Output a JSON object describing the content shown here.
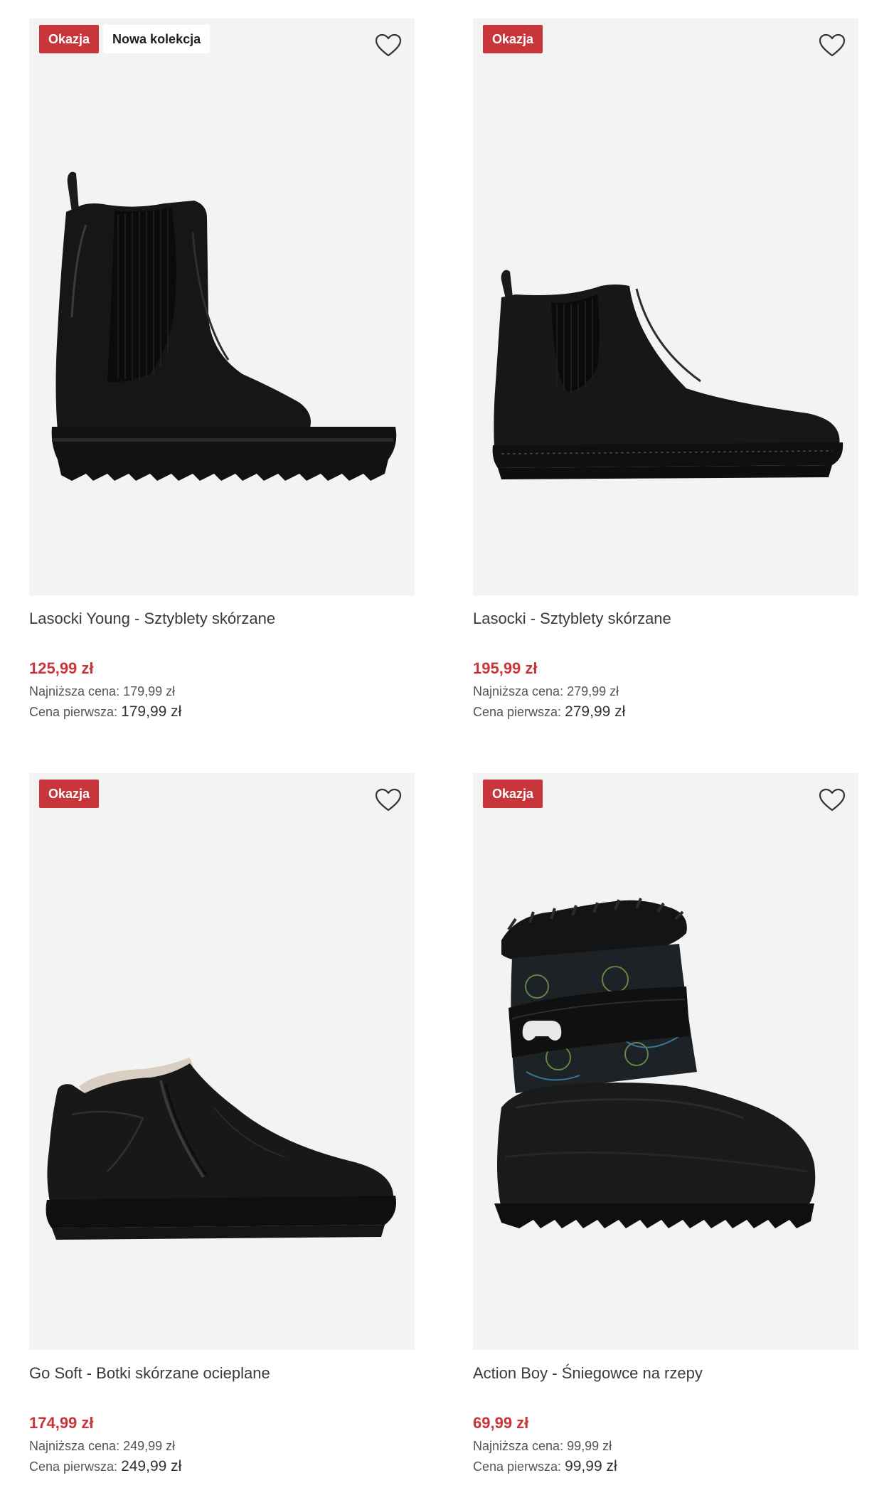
{
  "products": [
    {
      "badges": [
        "Okazja",
        "Nowa kolekcja"
      ],
      "name": "Lasocki Young - Sztyblety skórzane",
      "price": "125,99 zł",
      "lowest_label": "Najniższa cena:",
      "lowest_value": "179,99 zł",
      "first_label": "Cena pierwsza:",
      "first_value": "179,99 zł"
    },
    {
      "badges": [
        "Okazja"
      ],
      "name": "Lasocki - Sztyblety skórzane",
      "price": "195,99 zł",
      "lowest_label": "Najniższa cena:",
      "lowest_value": "279,99 zł",
      "first_label": "Cena pierwsza:",
      "first_value": "279,99 zł"
    },
    {
      "badges": [
        "Okazja"
      ],
      "name": "Go Soft - Botki skórzane ocieplane",
      "price": "174,99 zł",
      "lowest_label": "Najniższa cena:",
      "lowest_value": "249,99 zł",
      "first_label": "Cena pierwsza:",
      "first_value": "249,99 zł"
    },
    {
      "badges": [
        "Okazja"
      ],
      "name": "Action Boy - Śniegowce na rzepy",
      "price": "69,99 zł",
      "lowest_label": "Najniższa cena:",
      "lowest_value": "99,99 zł",
      "first_label": "Cena pierwsza:",
      "first_value": "99,99 zł"
    }
  ],
  "icons": {
    "wishlist": "heart-outline-icon"
  },
  "colors": {
    "sale_red": "#c8353b",
    "image_bg": "#f3f3f3"
  }
}
